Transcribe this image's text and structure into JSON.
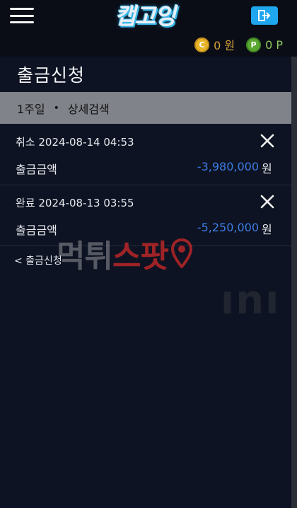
{
  "header": {
    "logo_text": "캡고잉",
    "menu_icon": "hamburger-menu-icon",
    "logout_icon": "logout-icon",
    "logout_color": "#1ea6ef"
  },
  "balances": {
    "cash_coin_letter": "C",
    "cash_value": "0 원",
    "point_coin_letter": "P",
    "point_value": "0 P"
  },
  "page": {
    "title": "출금신청",
    "back_link": "< 출금신청"
  },
  "filter": {
    "period": "1주일",
    "separator": "•",
    "detail_search": "상세검색"
  },
  "entries": [
    {
      "status": "취소",
      "datetime": "2024-08-14 04:53",
      "label": "출금금액",
      "amount": "-3,980,000",
      "unit": "원"
    },
    {
      "status": "완료",
      "datetime": "2024-08-13 03:55",
      "label": "출금금액",
      "amount": "-5,250,000",
      "unit": "원"
    }
  ],
  "watermark": {
    "text_part1": "먹튀",
    "text_part2": "스팟",
    "ghost_text": "ını"
  },
  "colors": {
    "background": "#0d1322",
    "amount_blue": "#3d7de6",
    "filter_bar": "#808389"
  }
}
